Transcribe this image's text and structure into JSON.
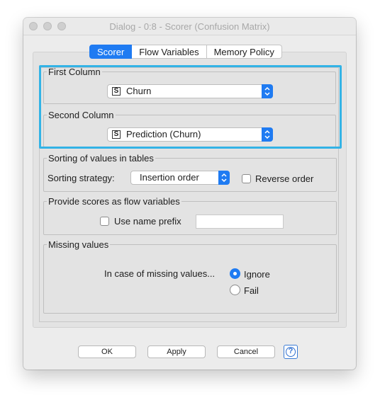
{
  "window": {
    "title": "Dialog - 0:8 - Scorer (Confusion Matrix)"
  },
  "tabs": [
    {
      "label": "Scorer",
      "active": true
    },
    {
      "label": "Flow Variables",
      "active": false
    },
    {
      "label": "Memory Policy",
      "active": false
    }
  ],
  "first_column": {
    "legend": "First Column",
    "type_icon": "S",
    "value": "Churn"
  },
  "second_column": {
    "legend": "Second Column",
    "type_icon": "S",
    "value": "Prediction (Churn)"
  },
  "sorting": {
    "legend": "Sorting of values in tables",
    "strategy_label": "Sorting strategy:",
    "strategy_value": "Insertion order",
    "reverse_label": "Reverse order",
    "reverse_checked": false
  },
  "flow_vars": {
    "legend": "Provide scores as flow variables",
    "prefix_label": "Use name prefix",
    "prefix_checked": false,
    "prefix_value": ""
  },
  "missing": {
    "legend": "Missing values",
    "prompt": "In case of missing values...",
    "options": [
      {
        "label": "Ignore",
        "selected": true
      },
      {
        "label": "Fail",
        "selected": false
      }
    ]
  },
  "buttons": {
    "ok": "OK",
    "apply": "Apply",
    "cancel": "Cancel",
    "help": "?"
  },
  "colors": {
    "accent": "#1f7bf2",
    "focus": "#33b3e6"
  }
}
